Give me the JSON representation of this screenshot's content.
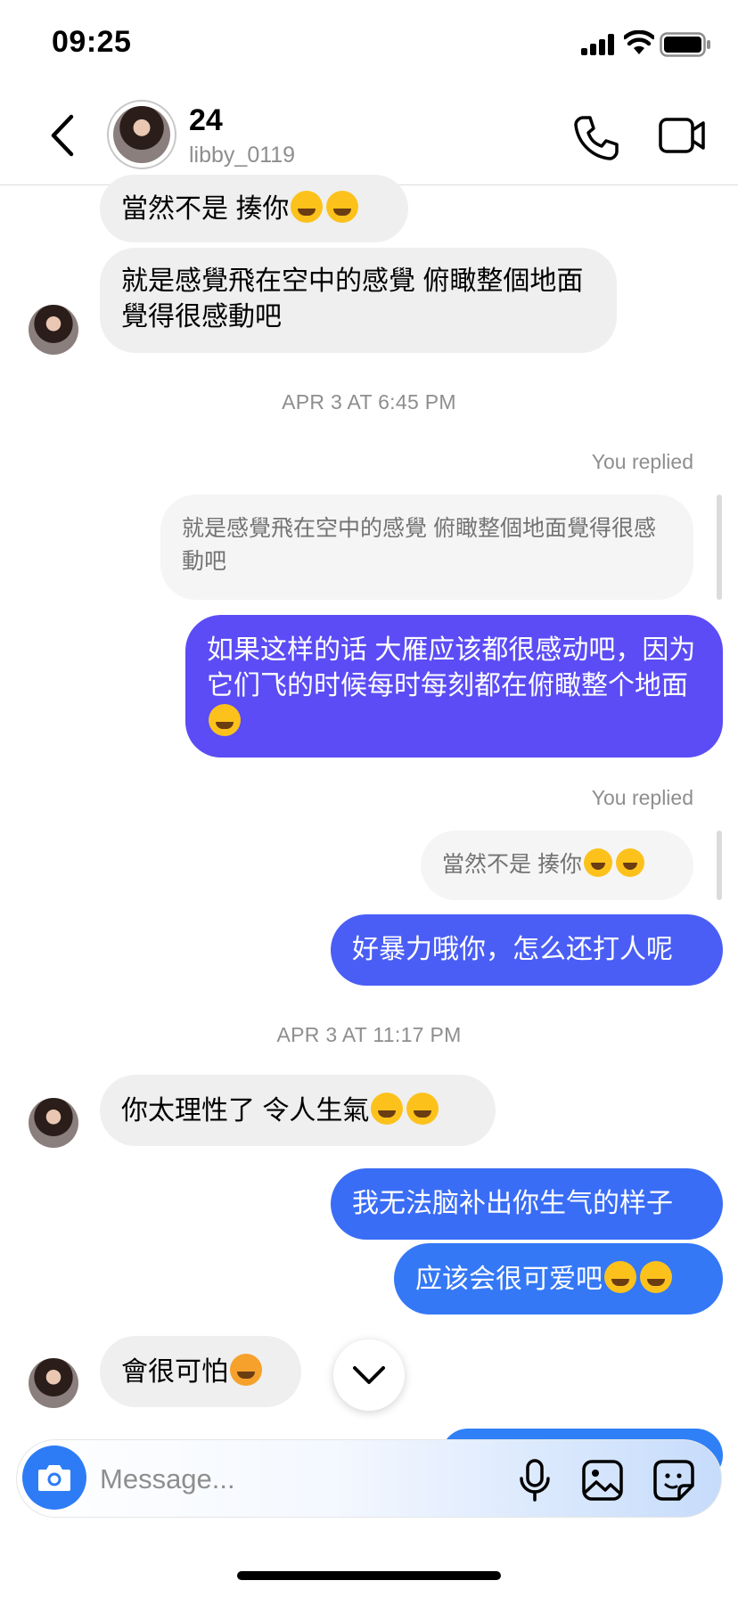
{
  "status_bar": {
    "time": "09:25"
  },
  "header": {
    "name": "24",
    "handle": "libby_0119"
  },
  "messages": {
    "m1": "當然不是 揍你",
    "m2": "就是感覺飛在空中的感覺 俯瞰整個地面覺得很感動吧",
    "ts1": "APR 3 AT 6:45 PM",
    "replied1": "You replied",
    "quote1": "就是感覺飛在空中的感覺 俯瞰整個地面覺得很感動吧",
    "reply1": "如果这样的话 大雁应该都很感动吧，因为它们飞的时候每时每刻都在俯瞰整个地面",
    "replied2": "You replied",
    "quote2": "當然不是 揍你",
    "reply2": "好暴力哦你，怎么还打人呢",
    "ts2": "APR 3 AT 11:17 PM",
    "m3": "你太理性了 令人生氣",
    "reply3": "我无法脑补出你生气的样子",
    "reply4": "应该会很可爱吧",
    "m4": "會很可怕"
  },
  "composer": {
    "placeholder": "Message..."
  },
  "colors": {
    "bubble_purple": "#5b4cf5",
    "bubble_indigo": "#4a5ef5",
    "bubble_blue": "#3478f6",
    "incoming_bubble": "#efefef",
    "camera_button": "#2d7cf6"
  },
  "icons": [
    "back-chevron-icon",
    "phone-icon",
    "video-camera-icon",
    "camera-icon",
    "microphone-icon",
    "gallery-icon",
    "sticker-icon",
    "chevron-down-icon",
    "signal-icon",
    "wifi-icon",
    "battery-icon"
  ]
}
